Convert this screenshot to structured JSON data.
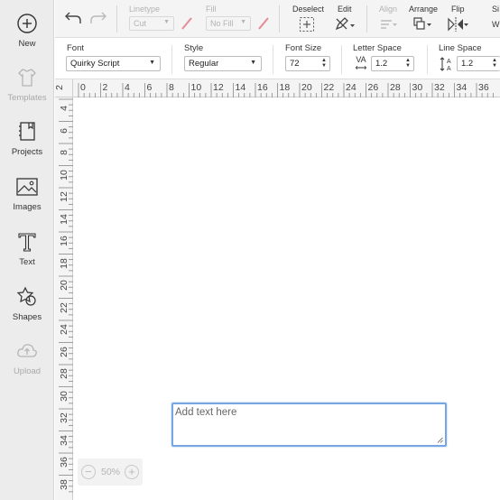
{
  "sidebar": {
    "items": [
      {
        "label": "New"
      },
      {
        "label": "Templates"
      },
      {
        "label": "Projects"
      },
      {
        "label": "Images"
      },
      {
        "label": "Text"
      },
      {
        "label": "Shapes"
      },
      {
        "label": "Upload"
      }
    ]
  },
  "toolbar": {
    "linetype_label": "Linetype",
    "linetype_value": "Cut",
    "fill_label": "Fill",
    "fill_value": "No Fill",
    "deselect_label": "Deselect",
    "edit_label": "Edit",
    "align_label": "Align",
    "arrange_label": "Arrange",
    "flip_label": "Flip",
    "size_label": "Si",
    "size_w": "W"
  },
  "text_toolbar": {
    "font_label": "Font",
    "font_value": "Quirky Script",
    "style_label": "Style",
    "style_value": "Regular",
    "font_size_label": "Font Size",
    "font_size_value": "72",
    "letter_space_label": "Letter Space",
    "letter_space_value": "1.2",
    "line_space_label": "Line Space",
    "line_space_value": "1.2",
    "letter_space_icon_text": "VA"
  },
  "ruler": {
    "top": [
      "0",
      "2",
      "4",
      "6",
      "8",
      "10",
      "12",
      "14",
      "16",
      "18",
      "20",
      "22",
      "24",
      "26",
      "28",
      "30",
      "32",
      "34",
      "36"
    ],
    "corner": "2",
    "left": [
      "4",
      "6",
      "8",
      "10",
      "12",
      "14",
      "16",
      "18",
      "20",
      "22",
      "24",
      "26",
      "28",
      "30",
      "32",
      "34",
      "36",
      "38"
    ]
  },
  "canvas": {
    "textbox_placeholder": "Add text here"
  },
  "zoom": {
    "value": "50%",
    "minus": "−",
    "plus": "+"
  },
  "colors": {
    "sidebar_bg": "#ececec",
    "accent_blue": "#76a7e2",
    "disabled_red": "#e58a96"
  }
}
